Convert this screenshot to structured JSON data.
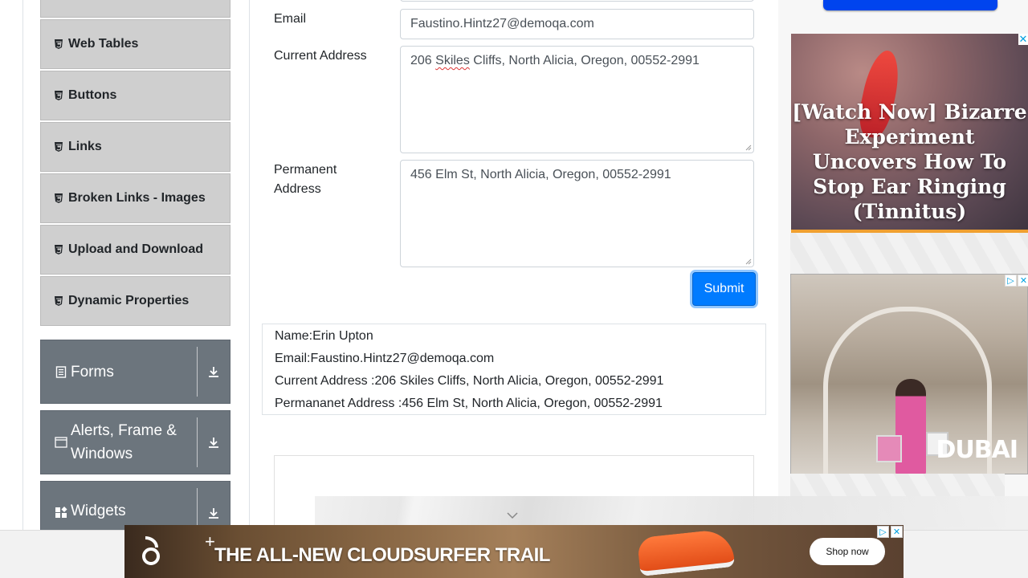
{
  "sidebar": {
    "items": [
      {
        "label": "Web Tables"
      },
      {
        "label": "Buttons"
      },
      {
        "label": "Links"
      },
      {
        "label": "Broken Links - Images"
      },
      {
        "label": "Upload and Download"
      },
      {
        "label": "Dynamic Properties"
      }
    ],
    "groups": [
      {
        "label": "Forms",
        "icon": "form-icon"
      },
      {
        "label": "Alerts, Frame & Windows",
        "icon": "window-icon"
      },
      {
        "label": "Widgets",
        "icon": "widgets-icon"
      }
    ]
  },
  "form": {
    "email_label": "Email",
    "email_value": "Faustino.Hintz27@demoqa.com",
    "current_address_label": "Current Address",
    "current_address_prefix": "206 ",
    "current_address_misspelled": "Skiles",
    "current_address_suffix": " Cliffs, North Alicia, Oregon, 00552-2991",
    "permanent_address_label_line1": "Permanent",
    "permanent_address_label_line2": "Address",
    "permanent_address_value": "456 Elm St, North Alicia, Oregon, 00552-2991",
    "submit_label": "Submit"
  },
  "output": {
    "name": "Name:Erin Upton",
    "email": "Email:Faustino.Hintz27@demoqa.com",
    "current_address": "Current Address :206 Skiles Cliffs, North Alicia, Oregon, 00552-2991",
    "permanent_address": "Permananet Address :456 Elm St, North Alicia, Oregon, 00552-2991"
  },
  "ads": {
    "right_top_headline": "[Watch Now] Bizarre Experiment Uncovers How To Stop Ear Ringing (Tinnitus)",
    "right_bottom_logo": "DUBAI",
    "bottom_banner_tagline": "THE ALL-NEW CLOUDSURFER TRAIL",
    "bottom_banner_cta": "Shop now",
    "close_glyph": "✕",
    "adchoices_glyph": "▷"
  },
  "colors": {
    "accent": "#007bff",
    "sidebar_item_bg": "#cfcfcf",
    "group_bg": "#6c757d"
  }
}
